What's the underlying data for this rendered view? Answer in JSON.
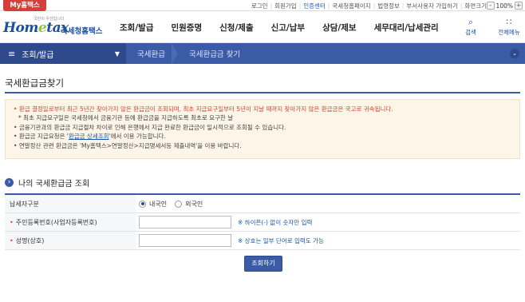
{
  "top": {
    "my_tab": "My홈택스",
    "links": [
      "로그인",
      "회원가입",
      "인증센터",
      "국세청홈페이지",
      "법령정보",
      "부서사용자 가입하기",
      "화면크기"
    ],
    "zoom": "100%",
    "zoom_minus": "-",
    "zoom_plus": "+"
  },
  "header": {
    "logo_tagline": "국민이 우선입니다",
    "logo_text_a": "Hom",
    "logo_text_e": "e",
    "logo_text_b": "tax",
    "logo_org": "국세청홈택스",
    "gnb": [
      "조회/발급",
      "민원증명",
      "신청/제출",
      "신고/납부",
      "상담/제보",
      "세무대리/납세관리"
    ],
    "search_label": "검색",
    "allmenu_label": "전체메뉴"
  },
  "nav": {
    "menu_label": "조회/발급",
    "crumbs": [
      "국세환급",
      "국세환급금 찾기"
    ]
  },
  "page": {
    "title": "국세환급금찾기",
    "notices": [
      {
        "text": "환급 결정일로부터 최근 5년간 찾아가지 않은 환급금이 조회되며, 최초 지급요구일부터 5년이 지날 때까지 찾아가지 않은 환급금은 국고로 귀속됩니다.",
        "style": "red"
      },
      {
        "text": "* 최초 지급요구일은 국세청에서 금융기관 등에 환급금을 지급하도록 최초로 요구한 날",
        "style": "sub"
      },
      {
        "text": "금융기관과의 환급금 지급절차 차이로 인해 은행에서 지급 완료한 환급금이 일시적으로 조회될 수 있습니다.",
        "style": ""
      },
      {
        "text_pre": "환급금 지급요청은 '",
        "link": "환급금 상세조회",
        "text_post": "'에서 이용 가능합니다.",
        "style": "link"
      },
      {
        "text": "연말정산 관련 환급금은 'My홈택스>연말정산>지급명세서등 제출내역'을 이용 바랍니다.",
        "style": ""
      }
    ],
    "section_title": "나의 국세환급금 조회",
    "form": {
      "taxpayer_type_label": "납세자구분",
      "radio_domestic": "내국인",
      "radio_foreign": "외국인",
      "id_label": "주민등록번호(사업자등록번호)",
      "id_value": "",
      "id_hint": "※ 하이픈(-) 없이 숫자만 입력",
      "name_label": "성명(상호)",
      "name_value": "",
      "name_hint": "※ 상호는 일부 단어로 입력도 가능"
    },
    "submit_label": "조회하기"
  }
}
